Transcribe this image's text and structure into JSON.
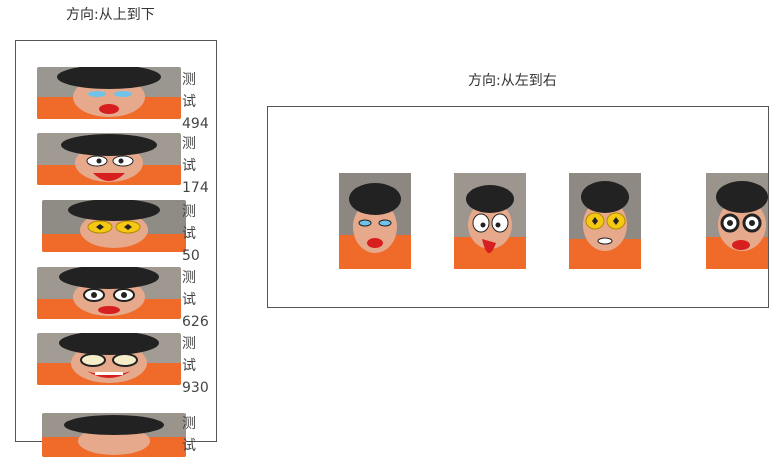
{
  "vertical": {
    "title": "方向:从上到下",
    "items": [
      {
        "char1": "测",
        "char2": "试",
        "num": "494",
        "face": "face-blue-eyes-lips"
      },
      {
        "char1": "测",
        "char2": "试",
        "num": "174",
        "face": "face-cartoon-eyes-tongue"
      },
      {
        "char1": "测",
        "char2": "试",
        "num": "50",
        "face": "face-yellow-goggles"
      },
      {
        "char1": "测",
        "char2": "试",
        "num": "626",
        "face": "face-round-glasses"
      },
      {
        "char1": "测",
        "char2": "试",
        "num": "930",
        "face": "face-big-eyes-grin"
      },
      {
        "char1": "测",
        "char2": "试",
        "num": "",
        "face": "face-partial"
      }
    ]
  },
  "horizontal": {
    "title": "方向:从左到右",
    "items": [
      {
        "face": "face-blue-eyes-lips"
      },
      {
        "face": "face-cartoon-eyes-tongue"
      },
      {
        "face": "face-yellow-goggles"
      },
      {
        "face": "face-round-glasses"
      }
    ]
  },
  "colors": {
    "border": "#555555",
    "text": "#333333",
    "jacket": "#f06a2a",
    "hat": "#222222",
    "skin": "#e7a98c",
    "lips": "#d81f1f",
    "goggles": "#f5c814"
  }
}
